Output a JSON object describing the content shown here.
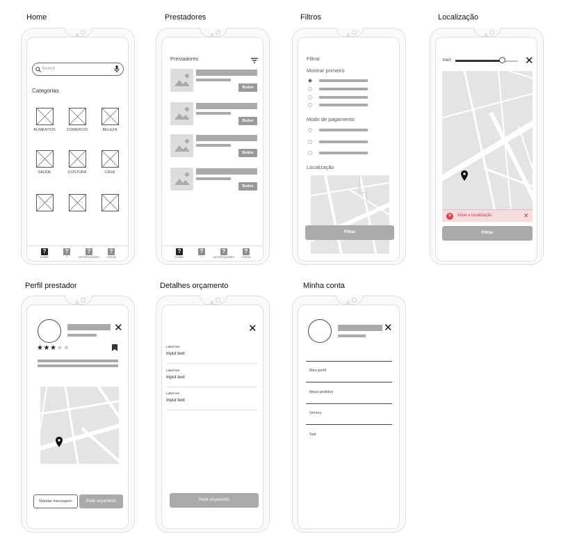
{
  "frames": {
    "home": "Home",
    "prestadores": "Prestadores",
    "filtros": "Filtros",
    "localizacao": "Localização",
    "perfil": "Perfil prestador",
    "detalhes": "Detalhes orçamento",
    "conta": "Minha conta"
  },
  "home": {
    "search_placeholder": "Search",
    "categories_heading": "Categorias",
    "categories": [
      "ALIMENTOS",
      "COMERCIO",
      "BELEZA",
      "SAÚDE",
      "COSTURA",
      "CASA",
      "",
      "",
      ""
    ]
  },
  "nav": {
    "items": [
      "HOME",
      "?",
      "NOTIFICAÇÕES",
      "CONTA"
    ],
    "icon_glyph": "?"
  },
  "prestadores": {
    "title": "Prestadores",
    "button_label": "Button",
    "count": 4
  },
  "filtros": {
    "title": "Filtrar",
    "show_first_heading": "Mostrar primeiro",
    "payment_heading": "Modo de pagamento",
    "location_heading": "Localização",
    "apply_button": "Filtrar"
  },
  "localizacao": {
    "radius_label": "RAIO",
    "radius_value": 0.75,
    "alert_text": "Ative a localização",
    "apply_button": "Filtrar"
  },
  "perfil": {
    "rating_filled": 3,
    "rating_total": 5,
    "message_button": "Mandar mensagem",
    "quote_button": "Pedir orçamento"
  },
  "detalhes": {
    "fields": [
      {
        "label": "Label text",
        "value": "Input text"
      },
      {
        "label": "Label text",
        "value": "Input text"
      },
      {
        "label": "Label text",
        "value": "Input text"
      }
    ],
    "submit_button": "Pedir orçamento"
  },
  "conta": {
    "menu": [
      "Meu perfil",
      "Meus pedidos",
      "Servos",
      "Sair"
    ]
  },
  "colors": {
    "placeholder": "#aaaaaa",
    "button": "#999999",
    "alert_bg": "#f6dcdc",
    "alert_icon": "#d64545",
    "nav_icon": "#222222",
    "nav_icon_inactive": "#8c8c8c"
  }
}
